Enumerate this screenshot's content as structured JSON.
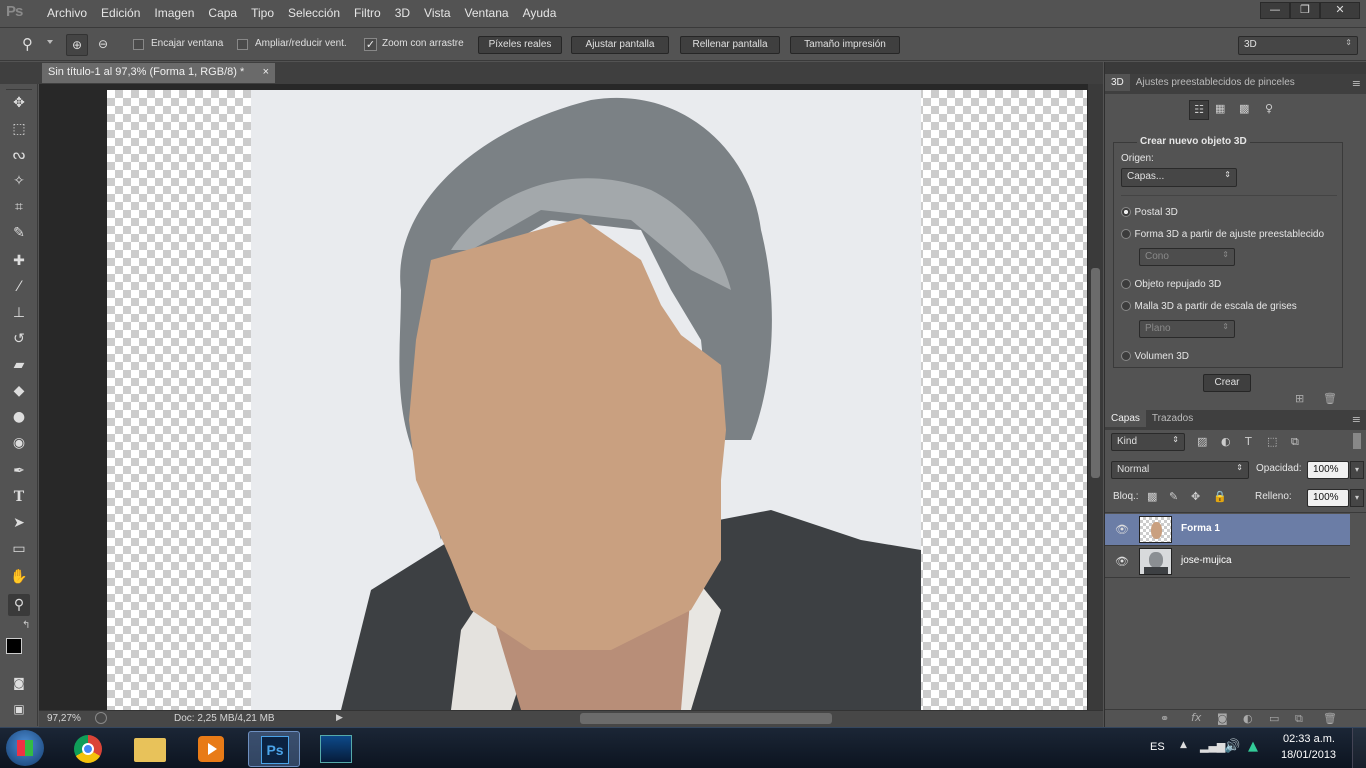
{
  "app": {
    "logo": "Ps"
  },
  "menu": [
    "Archivo",
    "Edición",
    "Imagen",
    "Capa",
    "Tipo",
    "Selección",
    "Filtro",
    "3D",
    "Vista",
    "Ventana",
    "Ayuda"
  ],
  "window_buttons": {
    "minimize": "—",
    "restore": "❐",
    "close": "✕"
  },
  "options": {
    "zoom_icon": "⚲",
    "fit_window": "Encajar ventana",
    "resize_windows": "Ampliar/reducir vent.",
    "scrubby_zoom": "Zoom con arrastre",
    "scrubby_checked": true,
    "actual_pixels": "Píxeles reales",
    "fit_screen": "Ajustar pantalla",
    "fill_screen": "Rellenar pantalla",
    "print_size": "Tamaño impresión",
    "workspace": "3D"
  },
  "document": {
    "tab_title": "Sin título-1 al 97,3% (Forma 1, RGB/8) *",
    "close": "×"
  },
  "status": {
    "zoom": "97,27%",
    "doc": "Doc: 2,25 MB/4,21 MB"
  },
  "panel3d": {
    "tabs": [
      "3D",
      "Ajustes preestablecidos de pinceles"
    ],
    "section_title": "Crear nuevo objeto 3D",
    "source_label": "Origen:",
    "source_value": "Capas...",
    "options": [
      {
        "label": "Postal 3D",
        "checked": true
      },
      {
        "label": "Forma 3D a partir de ajuste preestablecido",
        "checked": false
      },
      {
        "label": "Objeto repujado 3D",
        "checked": false
      },
      {
        "label": "Malla 3D a partir de escala de grises",
        "checked": false
      },
      {
        "label": "Volumen 3D",
        "checked": false
      }
    ],
    "preset_shape": "Cono",
    "grayscale_mesh": "Plano",
    "create_button": "Crear"
  },
  "layers_panel": {
    "tabs": [
      "Capas",
      "Trazados"
    ],
    "kind": "Kind",
    "blend_mode": "Normal",
    "opacity_label": "Opacidad:",
    "opacity_value": "100%",
    "lock_label": "Bloq.:",
    "fill_label": "Relleno:",
    "fill_value": "100%",
    "layers": [
      {
        "name": "Forma 1",
        "selected": true
      },
      {
        "name": "jose-mujica",
        "selected": false
      }
    ]
  },
  "taskbar": {
    "lang": "ES",
    "time": "02:33 a.m.",
    "date": "18/01/2013",
    "ps_label": "Ps"
  },
  "colors": {
    "face_mask": "#c9a080",
    "selection": "#6b7da6",
    "chrome": "#535353"
  }
}
